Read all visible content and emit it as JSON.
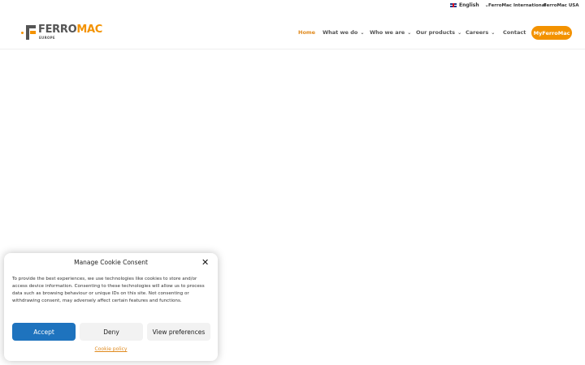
{
  "topbar": {
    "language": "English",
    "links": [
      "FerroMac International",
      "FerroMac USA"
    ]
  },
  "logo": {
    "brand_part1": "FERRO",
    "brand_part2": "MAC",
    "sub": "EUROPE"
  },
  "nav": {
    "items": [
      {
        "label": "Home",
        "active": true
      },
      {
        "label": "What we do"
      },
      {
        "label": "Who we are"
      },
      {
        "label": "Our products"
      },
      {
        "label": "Careers"
      },
      {
        "label": "Contact"
      }
    ],
    "cta": "MyFerroMac"
  },
  "cookie": {
    "title": "Manage Cookie Consent",
    "text": "To provide the best experiences, we use technologies like cookies to store and/or access device information. Consenting to these technologies will allow us to process data such as browsing behaviour or unique IDs on this site. Not consenting or withdrawing consent, may adversely affect certain features and functions.",
    "accept": "Accept",
    "deny": "Deny",
    "preferences": "View preferences",
    "policy": "Cookie policy"
  },
  "colors": {
    "accent": "#f39200",
    "primary_button": "#1e73be"
  }
}
